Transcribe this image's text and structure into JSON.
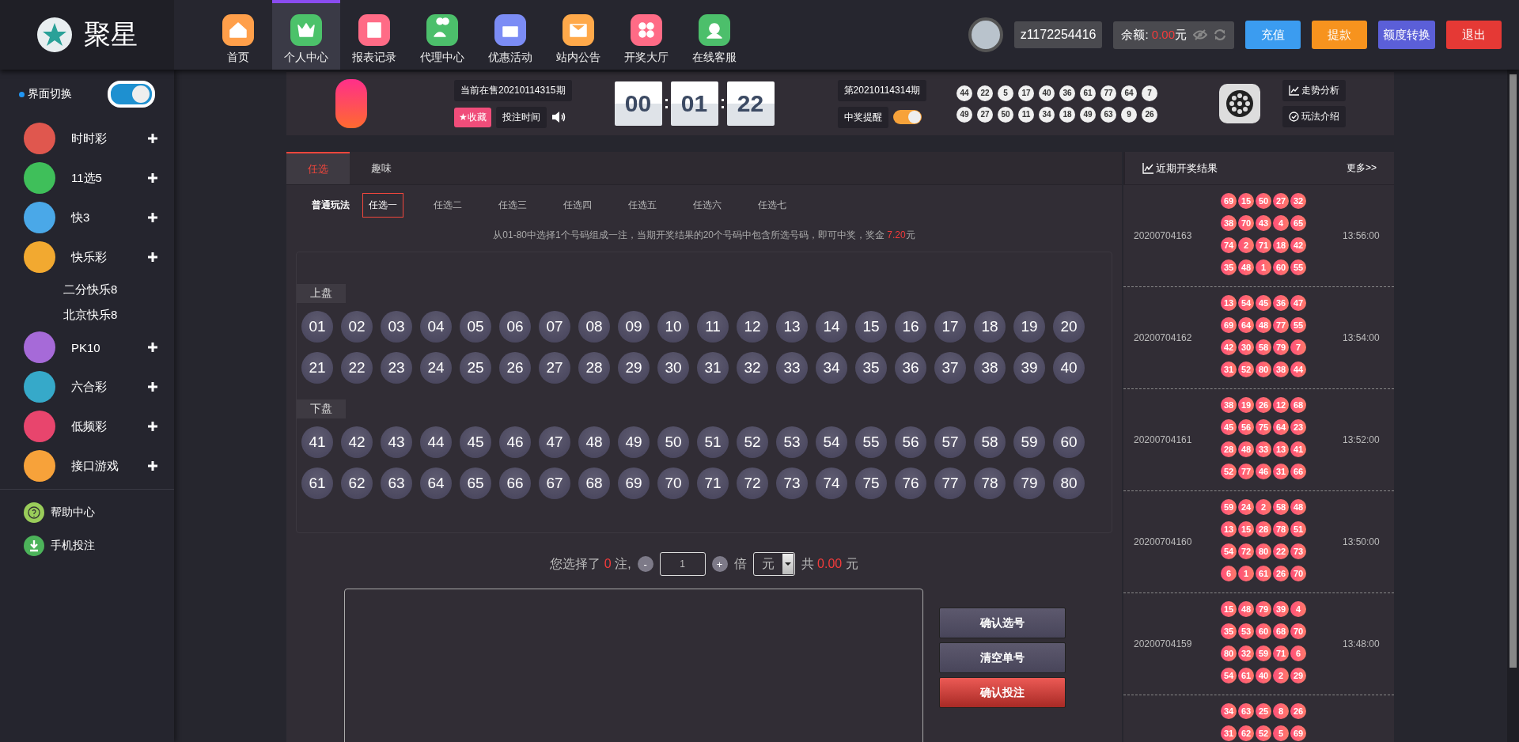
{
  "logo": {
    "text": "聚星"
  },
  "nav": [
    {
      "label": "首页",
      "selected": false,
      "color": "#ff9f4a",
      "kind": "home"
    },
    {
      "label": "个人中心",
      "selected": true,
      "color": "#4cc26a",
      "kind": "crown"
    },
    {
      "label": "报表记录",
      "selected": false,
      "color": "#ff6b86",
      "kind": "report"
    },
    {
      "label": "代理中心",
      "selected": false,
      "color": "#4cbf6b",
      "kind": "people"
    },
    {
      "label": "优惠活动",
      "selected": false,
      "color": "#7b8cf5",
      "kind": "gift"
    },
    {
      "label": "站内公告",
      "selected": false,
      "color": "#ffa94a",
      "kind": "mail"
    },
    {
      "label": "开奖大厅",
      "selected": false,
      "color": "#ff6b86",
      "kind": "dots"
    },
    {
      "label": "在线客服",
      "selected": false,
      "color": "#4cbf6b",
      "kind": "support"
    }
  ],
  "user": {
    "username": "z1172254416",
    "balance_label": "余额:",
    "balance": "0.00",
    "balance_unit": "元"
  },
  "actions": [
    {
      "label": "充值",
      "color": "#3b9cf0"
    },
    {
      "label": "提款",
      "color": "#f7931e"
    },
    {
      "label": "额度转换",
      "color": "#5b5fd8"
    },
    {
      "label": "退出",
      "color": "#e53935"
    }
  ],
  "sidebar": {
    "switch_label": "界面切换",
    "switch_on": true,
    "items": [
      {
        "label": "时时彩",
        "color": "#e0574e"
      },
      {
        "label": "11选5",
        "color": "#3fbf5a"
      },
      {
        "label": "快3",
        "color": "#4aa8e8"
      },
      {
        "label": "快乐彩",
        "color": "#f2a930",
        "children": [
          {
            "label": "二分快乐8"
          },
          {
            "label": "北京快乐8"
          }
        ]
      },
      {
        "label": "PK10",
        "color": "#a66ad8"
      },
      {
        "label": "六合彩",
        "color": "#36a9c9"
      },
      {
        "label": "低频彩",
        "color": "#e8456d"
      },
      {
        "label": "接口游戏",
        "color": "#f7a23a"
      }
    ],
    "footer": [
      {
        "label": "帮助中心",
        "kind": "help"
      },
      {
        "label": "手机投注",
        "kind": "download"
      }
    ]
  },
  "draw_header": {
    "current_label": "当前在售20210114315期",
    "favorite": "★收藏",
    "bet_time": "投注时间",
    "countdown": [
      "00",
      "01",
      "22"
    ],
    "last_issue": "第20210114314期",
    "win_alert_label": "中奖提醒",
    "win_alert_on": true,
    "last_numbers": [
      "44",
      "22",
      "5",
      "17",
      "40",
      "36",
      "61",
      "77",
      "64",
      "7",
      "49",
      "27",
      "50",
      "11",
      "34",
      "18",
      "49",
      "63",
      "9",
      "26"
    ],
    "links": [
      {
        "label": "走势分析",
        "kind": "trend"
      },
      {
        "label": "玩法介绍",
        "kind": "rules"
      }
    ]
  },
  "tabs": [
    {
      "label": "任选",
      "selected": true
    },
    {
      "label": "趣味",
      "selected": false
    }
  ],
  "play": {
    "group_label": "普通玩法",
    "options": [
      {
        "label": "任选一",
        "selected": true
      },
      {
        "label": "任选二",
        "selected": false
      },
      {
        "label": "任选三",
        "selected": false
      },
      {
        "label": "任选四",
        "selected": false
      },
      {
        "label": "任选五",
        "selected": false
      },
      {
        "label": "任选六",
        "selected": false
      },
      {
        "label": "任选七",
        "selected": false
      }
    ]
  },
  "hint": {
    "text": "从01-80中选择1个号码组成一注，当期开奖结果的20个号码中包含所选号码，即可中奖，奖金",
    "prize": "7.20",
    "unit": "元"
  },
  "board": {
    "sections": [
      {
        "label": "上盘",
        "numbers": [
          {
            "n": "01",
            "selected": false
          },
          {
            "n": "02",
            "selected": false
          },
          {
            "n": "03",
            "selected": false
          },
          {
            "n": "04",
            "selected": false
          },
          {
            "n": "05",
            "selected": false
          },
          {
            "n": "06",
            "selected": false
          },
          {
            "n": "07",
            "selected": false
          },
          {
            "n": "08",
            "selected": false
          },
          {
            "n": "09",
            "selected": false
          },
          {
            "n": "10",
            "selected": false
          },
          {
            "n": "11",
            "selected": false
          },
          {
            "n": "12",
            "selected": false
          },
          {
            "n": "13",
            "selected": false
          },
          {
            "n": "14",
            "selected": false
          },
          {
            "n": "15",
            "selected": false
          },
          {
            "n": "16",
            "selected": false
          },
          {
            "n": "17",
            "selected": false
          },
          {
            "n": "18",
            "selected": false
          },
          {
            "n": "19",
            "selected": false
          },
          {
            "n": "20",
            "selected": false
          },
          {
            "n": "21",
            "selected": false
          },
          {
            "n": "22",
            "selected": false
          },
          {
            "n": "23",
            "selected": false
          },
          {
            "n": "24",
            "selected": false
          },
          {
            "n": "25",
            "selected": false
          },
          {
            "n": "26",
            "selected": false
          },
          {
            "n": "27",
            "selected": false
          },
          {
            "n": "28",
            "selected": false
          },
          {
            "n": "29",
            "selected": false
          },
          {
            "n": "30",
            "selected": false
          },
          {
            "n": "31",
            "selected": false
          },
          {
            "n": "32",
            "selected": false
          },
          {
            "n": "33",
            "selected": false
          },
          {
            "n": "34",
            "selected": false
          },
          {
            "n": "35",
            "selected": false
          },
          {
            "n": "36",
            "selected": false
          },
          {
            "n": "37",
            "selected": false
          },
          {
            "n": "38",
            "selected": false
          },
          {
            "n": "39",
            "selected": false
          },
          {
            "n": "40",
            "selected": false
          }
        ]
      },
      {
        "label": "下盘",
        "numbers": [
          {
            "n": "41",
            "selected": false
          },
          {
            "n": "42",
            "selected": false
          },
          {
            "n": "43",
            "selected": false
          },
          {
            "n": "44",
            "selected": false
          },
          {
            "n": "45",
            "selected": false
          },
          {
            "n": "46",
            "selected": false
          },
          {
            "n": "47",
            "selected": false
          },
          {
            "n": "48",
            "selected": false
          },
          {
            "n": "49",
            "selected": false
          },
          {
            "n": "50",
            "selected": false
          },
          {
            "n": "51",
            "selected": false
          },
          {
            "n": "52",
            "selected": false
          },
          {
            "n": "53",
            "selected": false
          },
          {
            "n": "54",
            "selected": false
          },
          {
            "n": "55",
            "selected": false
          },
          {
            "n": "56",
            "selected": false
          },
          {
            "n": "57",
            "selected": false
          },
          {
            "n": "58",
            "selected": false
          },
          {
            "n": "59",
            "selected": false
          },
          {
            "n": "60",
            "selected": false
          },
          {
            "n": "61",
            "selected": false
          },
          {
            "n": "62",
            "selected": false
          },
          {
            "n": "63",
            "selected": false
          },
          {
            "n": "64",
            "selected": false
          },
          {
            "n": "65",
            "selected": false
          },
          {
            "n": "66",
            "selected": false
          },
          {
            "n": "67",
            "selected": false
          },
          {
            "n": "68",
            "selected": false
          },
          {
            "n": "69",
            "selected": false
          },
          {
            "n": "70",
            "selected": false
          },
          {
            "n": "71",
            "selected": false
          },
          {
            "n": "72",
            "selected": false
          },
          {
            "n": "73",
            "selected": false
          },
          {
            "n": "74",
            "selected": false
          },
          {
            "n": "75",
            "selected": false
          },
          {
            "n": "76",
            "selected": false
          },
          {
            "n": "77",
            "selected": false
          },
          {
            "n": "78",
            "selected": false
          },
          {
            "n": "79",
            "selected": false
          },
          {
            "n": "80",
            "selected": false
          }
        ]
      }
    ]
  },
  "summary": {
    "prefix": "您选择了",
    "count": "0",
    "unit": "注,",
    "minus": "-",
    "multiplier": "1",
    "plus": "+",
    "times": "倍",
    "currency": "元",
    "total_label": "共",
    "total": "0.00",
    "total_unit": "元"
  },
  "bet_buttons": [
    {
      "label": "确认选号",
      "kind": "secondary"
    },
    {
      "label": "清空单号",
      "kind": "secondary"
    },
    {
      "label": "确认投注",
      "kind": "primary"
    }
  ],
  "results": {
    "title": "近期开奖结果",
    "more": "更多>>",
    "rows": [
      {
        "issue": "20200704163",
        "time": "13:56:00",
        "numbers": [
          "69",
          "15",
          "50",
          "27",
          "32",
          "38",
          "70",
          "43",
          "4",
          "65",
          "74",
          "2",
          "71",
          "18",
          "42",
          "35",
          "48",
          "1",
          "60",
          "55"
        ]
      },
      {
        "issue": "20200704162",
        "time": "13:54:00",
        "numbers": [
          "13",
          "54",
          "45",
          "36",
          "47",
          "69",
          "64",
          "48",
          "77",
          "55",
          "42",
          "30",
          "58",
          "79",
          "7",
          "31",
          "52",
          "80",
          "38",
          "44"
        ]
      },
      {
        "issue": "20200704161",
        "time": "13:52:00",
        "numbers": [
          "38",
          "19",
          "26",
          "12",
          "68",
          "45",
          "56",
          "75",
          "64",
          "23",
          "28",
          "48",
          "33",
          "13",
          "41",
          "52",
          "77",
          "46",
          "31",
          "66"
        ]
      },
      {
        "issue": "20200704160",
        "time": "13:50:00",
        "numbers": [
          "59",
          "24",
          "2",
          "58",
          "48",
          "13",
          "15",
          "28",
          "78",
          "51",
          "54",
          "72",
          "80",
          "22",
          "73",
          "6",
          "1",
          "61",
          "26",
          "70"
        ]
      },
      {
        "issue": "20200704159",
        "time": "13:48:00",
        "numbers": [
          "15",
          "48",
          "79",
          "39",
          "4",
          "35",
          "53",
          "60",
          "68",
          "70",
          "80",
          "32",
          "59",
          "71",
          "6",
          "54",
          "61",
          "40",
          "2",
          "29"
        ]
      },
      {
        "numbers": [
          "34",
          "63",
          "25",
          "8",
          "26",
          "31",
          "62",
          "52",
          "5",
          "69"
        ]
      }
    ]
  }
}
